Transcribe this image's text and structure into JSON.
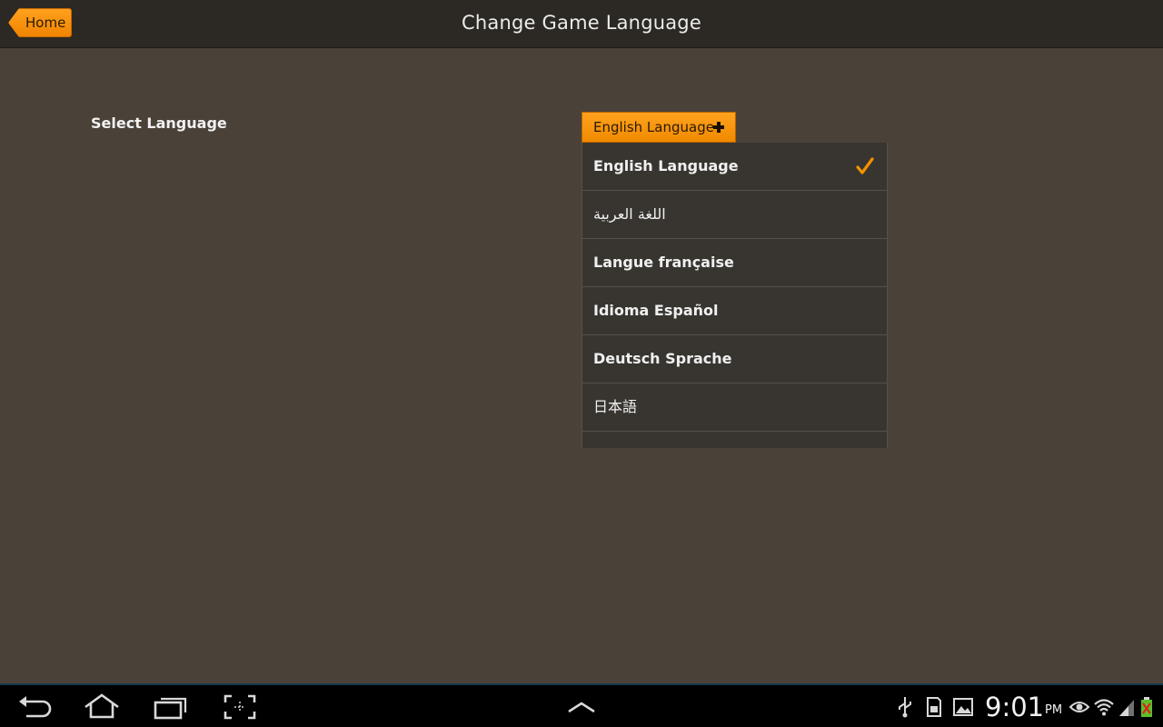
{
  "header": {
    "home_label": "Home",
    "title": "Change Game Language"
  },
  "content": {
    "select_label": "Select Language",
    "dropdown": {
      "selected_label": "English Language",
      "options": [
        {
          "label": "English Language",
          "selected": true
        },
        {
          "label": "اللغة العربية",
          "selected": false
        },
        {
          "label": "Langue française",
          "selected": false
        },
        {
          "label": "Idioma Español",
          "selected": false
        },
        {
          "label": "Deutsch Sprache",
          "selected": false
        },
        {
          "label": "日本語",
          "selected": false
        }
      ]
    }
  },
  "system_bar": {
    "nav_icons": [
      "back-icon",
      "home-icon",
      "recent-apps-icon",
      "screenshot-icon",
      "up-chevron-icon"
    ],
    "status_icons": [
      "usb-icon",
      "sd-card-icon",
      "gallery-icon",
      "eye-icon",
      "wifi-icon",
      "signal-icon",
      "battery-icon"
    ],
    "time": "9:01",
    "ampm": "PM"
  },
  "colors": {
    "accent": "#f39200",
    "background": "#4a4239",
    "header": "#2c2924",
    "list_background": "#383531"
  }
}
